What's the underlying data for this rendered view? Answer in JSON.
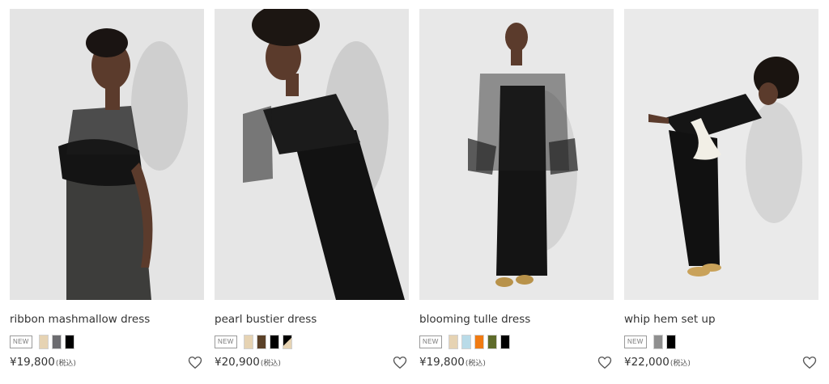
{
  "products": [
    {
      "name": "ribbon mashmallow dress",
      "badge": "NEW",
      "price": "¥19,800",
      "tax": "(税込)",
      "swatches": [
        "#e6d3b3",
        "#6c6c70",
        "#000000"
      ],
      "photo_icon": "model-photo"
    },
    {
      "name": "pearl bustier dress",
      "badge": "NEW",
      "price": "¥20,900",
      "tax": "(税込)",
      "swatches": [
        "#e6d3b3",
        "#5b4128",
        "#000000",
        "black-beige-split"
      ],
      "photo_icon": "model-photo"
    },
    {
      "name": "blooming tulle dress",
      "badge": "NEW",
      "price": "¥19,800",
      "tax": "(税込)",
      "swatches": [
        "#e6d3b3",
        "#b9dbe8",
        "#f07a12",
        "#5e6b2a",
        "#000000"
      ],
      "photo_icon": "model-photo"
    },
    {
      "name": "whip hem set up",
      "badge": "NEW",
      "price": "¥22,000",
      "tax": "(税込)",
      "swatches": [
        "#8f8f8f",
        "#000000"
      ],
      "photo_icon": "model-photo"
    }
  ],
  "favorite_icon": "heart-outline-icon"
}
